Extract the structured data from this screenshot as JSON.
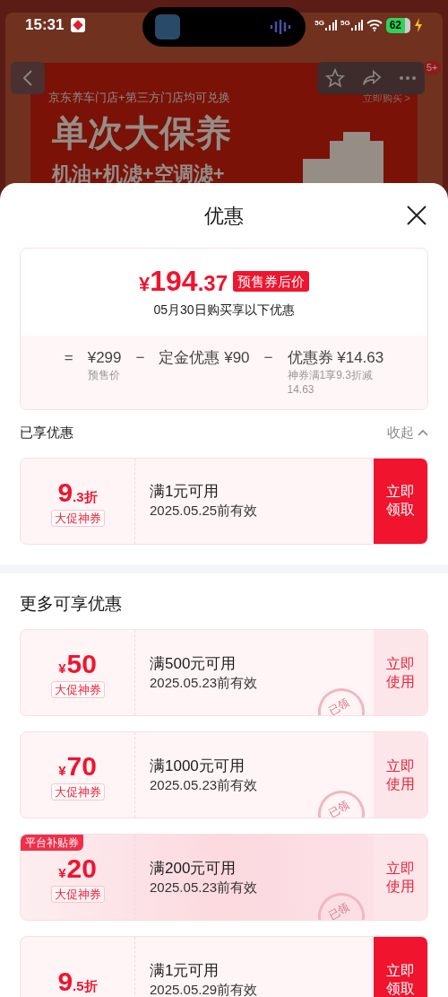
{
  "status_bar": {
    "time": "15:31",
    "signals": [
      "5G",
      "5G"
    ],
    "battery": "62"
  },
  "background_page": {
    "badge": "5+",
    "banner_caption": "京东养车门店+第三方门店均可兑换",
    "banner_link": "立即购买 >",
    "banner_title": "单次大保养",
    "banner_subtitle": "机油+机滤+空调滤+"
  },
  "sheet": {
    "title": "优惠",
    "summary": {
      "currency": "¥",
      "price_int": "194",
      "price_dec": ".37",
      "price_tag": "预售券后价",
      "note": "05月30日购买享以下优惠",
      "breakdown": [
        {
          "op": "=",
          "value": "¥299",
          "label": "预售价"
        },
        {
          "op": "−",
          "value": "定金优惠 ¥90"
        },
        {
          "op": "−",
          "value": "优惠券 ¥14.63",
          "label": "神券满1享9.3折减14.63"
        }
      ]
    },
    "applied": {
      "title": "已享优惠",
      "toggle": "收起",
      "expanded": true,
      "coupons": [
        {
          "kind": "discount",
          "big": "9",
          "small": ".3折",
          "tag": "大促神券",
          "condition": "满1元可用",
          "expiry": "2025.05.25前有效",
          "action": "立即领取",
          "claimed": false
        }
      ]
    },
    "more": {
      "title": "更多可享优惠",
      "coupons": [
        {
          "kind": "amount",
          "small": "¥",
          "big": "50",
          "tag": "大促神券",
          "condition": "满500元可用",
          "expiry": "2025.05.23前有效",
          "action": "立即使用",
          "claimed": true,
          "stamp": "已领"
        },
        {
          "kind": "amount",
          "small": "¥",
          "big": "70",
          "tag": "大促神券",
          "condition": "满1000元可用",
          "expiry": "2025.05.23前有效",
          "action": "立即使用",
          "claimed": true,
          "stamp": "已领"
        },
        {
          "kind": "amount",
          "small": "¥",
          "big": "20",
          "tag": "大促神券",
          "ribbon": "平台补贴券",
          "condition": "满200元可用",
          "expiry": "2025.05.23前有效",
          "action": "立即使用",
          "claimed": true,
          "stamp": "已领"
        },
        {
          "kind": "discount",
          "big": "9",
          "small": ".5折",
          "condition": "满1元可用",
          "expiry": "2025.05.29前有效",
          "action": "立即领取",
          "claimed": false
        }
      ]
    }
  }
}
